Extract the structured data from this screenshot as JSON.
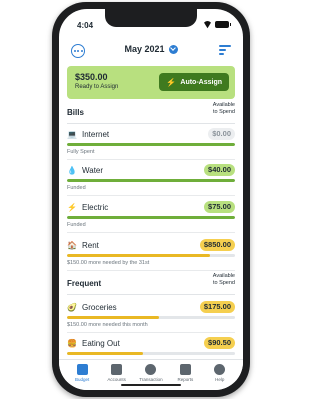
{
  "status": {
    "time": "4:04"
  },
  "header": {
    "month": "May 2021"
  },
  "assign": {
    "amount": "$350.00",
    "label": "Ready to Assign",
    "button_label": "Auto-Assign"
  },
  "groups": [
    {
      "title": "Bills",
      "column_label": "Available\nto Spend"
    },
    {
      "title": "Frequent",
      "column_label": "Available\nto Spend"
    }
  ],
  "rows": [
    {
      "icon": "laptop-icon",
      "name": "Internet",
      "amount": "$0.00",
      "status": "Fully Spent",
      "progress": 1.0
    },
    {
      "icon": "droplet-icon",
      "name": "Water",
      "amount": "$40.00",
      "status": "Funded",
      "progress": 1.0
    },
    {
      "icon": "lightning-icon",
      "name": "Electric",
      "amount": "$75.00",
      "status": "Funded",
      "progress": 1.0
    },
    {
      "icon": "house-icon",
      "name": "Rent",
      "amount": "$850.00",
      "status": "$150.00 more needed by the 31st",
      "progress": 0.85
    },
    {
      "icon": "avocado-icon",
      "name": "Groceries",
      "amount": "$175.00",
      "status": "$150.00 more needed this month",
      "progress": 0.55
    },
    {
      "icon": "burger-icon",
      "name": "Eating Out",
      "amount": "$90.50",
      "status": "",
      "progress": 0.45
    }
  ],
  "tabs": [
    {
      "label": "Budget",
      "icon": "budget-icon",
      "active": true
    },
    {
      "label": "Accounts",
      "icon": "bank-icon",
      "active": false
    },
    {
      "label": "Transaction",
      "icon": "plus-circle-icon",
      "active": false
    },
    {
      "label": "Reports",
      "icon": "bar-chart-icon",
      "active": false
    },
    {
      "label": "Help",
      "icon": "help-icon",
      "active": false
    }
  ],
  "colors": {
    "accent": "#2d7dd2",
    "assign_bg": "#b8e07f",
    "assign_button": "#3f7a1f",
    "funded": "#6fae3a",
    "underfunded": "#e9b824"
  }
}
